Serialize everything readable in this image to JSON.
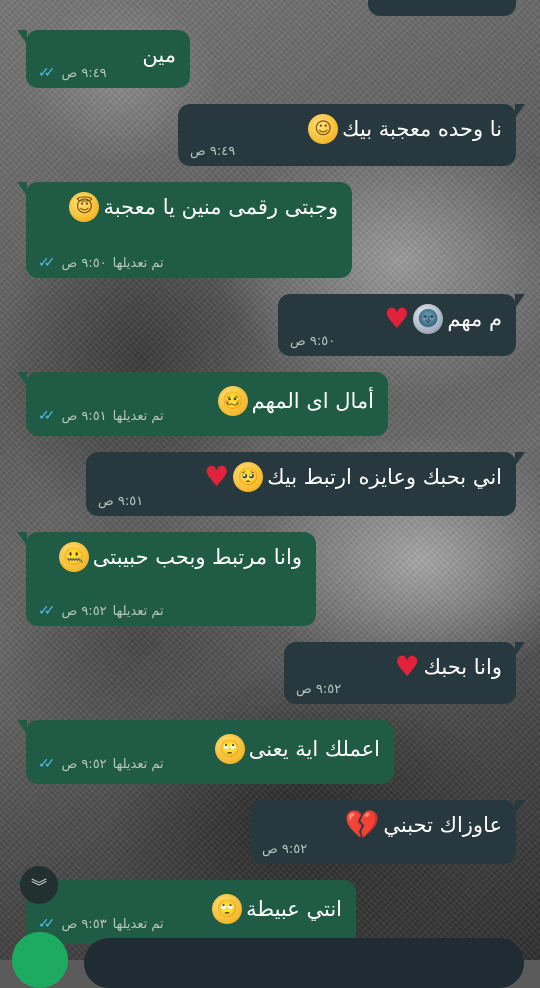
{
  "messages": [
    {
      "dir": "in",
      "text": "مين",
      "emoji": [],
      "time": "٩:٤٩ ص",
      "edited": ""
    },
    {
      "dir": "out",
      "text": "نا وحده معجبة بيك",
      "emoji": [
        "☺"
      ],
      "time": "٩:٤٩ ص",
      "edited": ""
    },
    {
      "dir": "in",
      "text": "وجبتى رقمى منين يا معجبة",
      "emoji": [
        "😇"
      ],
      "time": "٩:٥٠ ص",
      "edited": "تم تعديلها"
    },
    {
      "dir": "out",
      "text": "م مهم",
      "emoji": [
        "🌚",
        "♥"
      ],
      "time": "٩:٥٠ ص",
      "edited": ""
    },
    {
      "dir": "in",
      "text": "أمال اى المهم",
      "emoji": [
        "🥴"
      ],
      "time": "٩:٥١ ص",
      "edited": "تم تعديلها"
    },
    {
      "dir": "out",
      "text": "اني بحبك وعايزه ارتبط بيك",
      "emoji": [
        "🥺",
        "♥"
      ],
      "time": "٩:٥١ ص",
      "edited": ""
    },
    {
      "dir": "in",
      "text": "وانا مرتبط وبحب حبيبتى",
      "emoji": [
        "🤐"
      ],
      "time": "٩:٥٢ ص",
      "edited": "تم تعديلها"
    },
    {
      "dir": "out",
      "text": "وانا بحبك",
      "emoji": [
        "♥"
      ],
      "time": "٩:٥٢ ص",
      "edited": ""
    },
    {
      "dir": "in",
      "text": "اعملك اية يعنى",
      "emoji": [
        "🙄"
      ],
      "time": "٩:٥٢ ص",
      "edited": "تم تعديلها"
    },
    {
      "dir": "out",
      "text": "عاوزاك تحبني",
      "emoji": [
        "💔"
      ],
      "time": "٩:٥٢ ص",
      "edited": ""
    },
    {
      "dir": "in",
      "text": "انتي عبيطة",
      "emoji": [
        "🙄"
      ],
      "time": "٩:٥٣ ص",
      "edited": "تم تعديلها"
    }
  ],
  "icons": {
    "read_receipt": "double-check-icon",
    "scroll_down": "chevrons-down-icon"
  },
  "colors": {
    "incoming_bubble": "#1f5b45",
    "outgoing_bubble": "#28383f",
    "read_check": "#53bdeb"
  }
}
